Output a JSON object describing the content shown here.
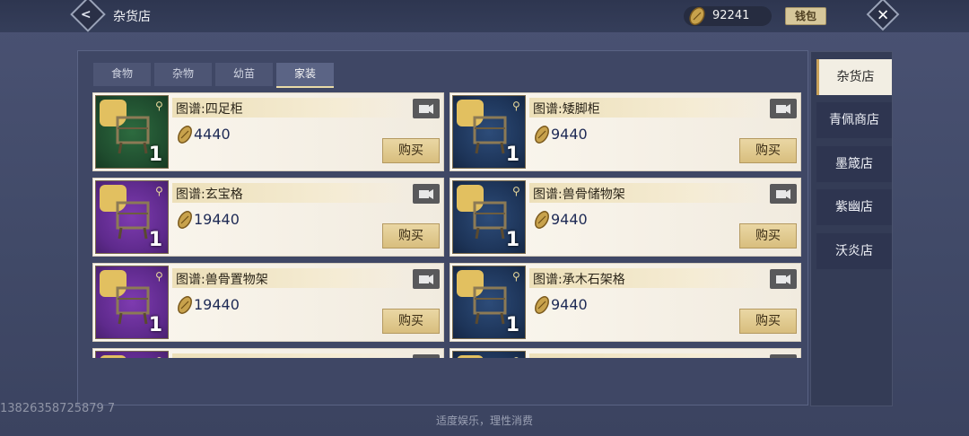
{
  "header": {
    "title": "杂货店",
    "currency_amount": "92241",
    "wallet_label": "钱包"
  },
  "tabs": [
    {
      "label": "食物",
      "active": false
    },
    {
      "label": "杂物",
      "active": false
    },
    {
      "label": "幼苗",
      "active": false
    },
    {
      "label": "家装",
      "active": true
    }
  ],
  "items": [
    {
      "name": "图谱:四足柜",
      "price": "4440",
      "qty": "1",
      "buy_label": "购买",
      "thumb_color": "green"
    },
    {
      "name": "图谱:矮脚柜",
      "price": "9440",
      "qty": "1",
      "buy_label": "购买",
      "thumb_color": "blue"
    },
    {
      "name": "图谱:玄宝格",
      "price": "19440",
      "qty": "1",
      "buy_label": "购买",
      "thumb_color": "purple"
    },
    {
      "name": "图谱:兽骨储物架",
      "price": "9440",
      "qty": "1",
      "buy_label": "购买",
      "thumb_color": "blue"
    },
    {
      "name": "图谱:兽骨置物架",
      "price": "19440",
      "qty": "1",
      "buy_label": "购买",
      "thumb_color": "purple"
    },
    {
      "name": "图谱:承木石架格",
      "price": "9440",
      "qty": "1",
      "buy_label": "购买",
      "thumb_color": "blue"
    },
    {
      "name": "",
      "price": "",
      "qty": "",
      "buy_label": "",
      "thumb_color": "purple"
    },
    {
      "name": "",
      "price": "",
      "qty": "",
      "buy_label": "",
      "thumb_color": "blue"
    }
  ],
  "sidebar": [
    {
      "label": "杂货店",
      "active": true
    },
    {
      "label": "青佩商店",
      "active": false
    },
    {
      "label": "墨箴店",
      "active": false
    },
    {
      "label": "紫幽店",
      "active": false
    },
    {
      "label": "沃炎店",
      "active": false
    }
  ],
  "watermark": "13826358725879 7",
  "footer_note": "适度娱乐，理性消费",
  "colors": {
    "accent_gold": "#d6c79a",
    "bg": "#4a5273",
    "price_text": "#1e2a55"
  }
}
